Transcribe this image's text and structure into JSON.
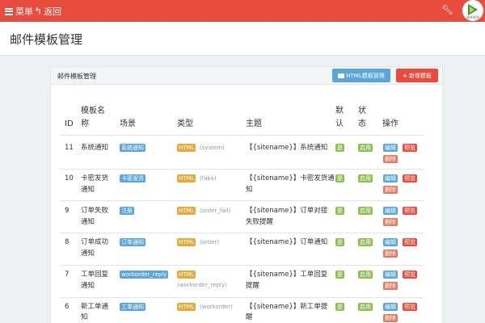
{
  "topbar": {
    "menu_label": "菜单",
    "back_label": "返回",
    "logo_caption": "猫咪视频"
  },
  "page": {
    "title": "邮件模板管理"
  },
  "card": {
    "title": "邮件模板管理",
    "html_button": "HTML模板管理",
    "add_button": "新增模板"
  },
  "table": {
    "headers": {
      "id": "ID",
      "name": [
        "模板名",
        "称"
      ],
      "scene": "场景",
      "type": "类型",
      "subject": "主题",
      "default": [
        "默",
        "认"
      ],
      "status": [
        "状",
        "态"
      ],
      "actions": "操作"
    },
    "rows": [
      {
        "id": "11",
        "name": [
          "系统通知"
        ],
        "scene": "系统通知",
        "type": "HTML",
        "type_note": "(system)",
        "subject": [
          "【{sitename}】系统通知"
        ],
        "default": "是",
        "status": "启用"
      },
      {
        "id": "10",
        "name": [
          "卡密发货",
          "通知"
        ],
        "scene": "卡密发货",
        "type": "HTML",
        "type_note": "(faka)",
        "subject": [
          "【{sitename}】卡密发货通",
          "知"
        ],
        "default": "是",
        "status": "启用"
      },
      {
        "id": "9",
        "name": [
          "订单失败",
          "通知"
        ],
        "scene": "注册",
        "type": "HTML",
        "type_note": "(order_fail)",
        "subject": [
          "【{sitename}】订单对接",
          "失败提醒"
        ],
        "default": "是",
        "status": "启用"
      },
      {
        "id": "8",
        "name": [
          "订单成功",
          "通知"
        ],
        "scene": "订单通知",
        "type": "HTML",
        "type_note": "(order)",
        "subject": [
          "【{sitename}】订单通知"
        ],
        "default": "是",
        "status": "启用"
      },
      {
        "id": "7",
        "name": [
          "工单回复",
          "通知"
        ],
        "scene": "workorder_reply",
        "type": "HTML",
        "type_note": "(workorder_reply)",
        "subject": [
          "【{sitename}】工单回复",
          "提醒"
        ],
        "default": "是",
        "status": "启用"
      },
      {
        "id": "6",
        "name": [
          "新工单通",
          "知"
        ],
        "scene": "工单通知",
        "type": "HTML",
        "type_note": "(workorder)",
        "subject": [
          "【{sitename}】新工单提",
          "醒"
        ],
        "default": "是",
        "status": "启用"
      }
    ],
    "actions": {
      "edit": "编辑",
      "preview": "预览",
      "delete": "删除"
    }
  },
  "colors": {
    "topbar": "#e84c3d",
    "label_blue": "#5aa6da",
    "label_orange": "#e8a93b",
    "label_green": "#8cc152",
    "button_red": "#e84c3d",
    "button_salmon": "#e07b5f"
  },
  "icons": {
    "menu": "hamburger-icon",
    "back": "back-arrow-icon",
    "settings": "wrench-icon",
    "logo": "play-logo-icon",
    "folder": "folder-icon",
    "plus": "plus-icon"
  }
}
